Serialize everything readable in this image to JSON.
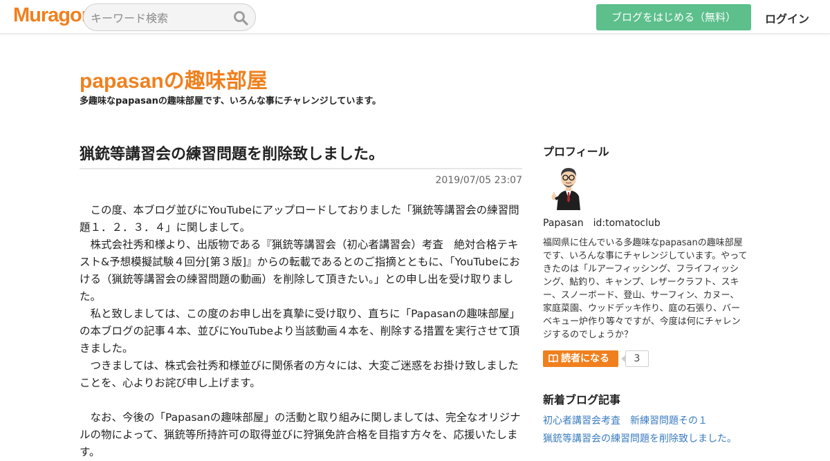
{
  "header": {
    "logo_text": "Muragon",
    "search_placeholder": "キーワード検索",
    "start_button": "ブログをはじめる（無料）",
    "login_link": "ログイン"
  },
  "blog": {
    "title": "papasanの趣味部屋",
    "description": "多趣味なpapasanの趣味部屋です、いろんな事にチャレンジしています。"
  },
  "article": {
    "title": "猟銃等講習会の練習問題を削除致しました。",
    "date": "2019/07/05 23:07",
    "paragraphs": [
      "　この度、本ブログ並びにYouTubeにアップロードしておりました「猟銃等講習会の練習問題１．２．３．４」に関しまして。",
      "　株式会社秀和様より、出版物である『猟銃等講習会（初心者講習会）考査　絶対合格テキスト&予想模擬試験４回分[第３版]』からの転載であるとのご指摘とともに、「YouTubeにおける（猟銃等講習会の練習問題の動画）を削除して頂きたい。」との申し出を受け取りました。",
      "　私と致しましては、この度のお申し出を真摯に受け取り、直ちに「Papasanの趣味部屋」の本ブログの記事４本、並びにYouTubeより当該動画４本を、削除する措置を実行させて頂きました。",
      "　つきましては、株式会社秀和様並びに関係者の方々には、大変ご迷惑をお掛け致しましたことを、心よりお詫び申し上げます。",
      "",
      "　なお、今後の「Papasanの趣味部屋」の活動と取り組みに関しましては、完全なオリジナルの物によって、猟銃等所持許可の取得並びに狩猟免許合格を目指す方々を、応援いたします。"
    ]
  },
  "sidebar": {
    "profile_heading": "プロフィール",
    "profile_name": "Papasan　id:tomatoclub",
    "profile_description": "福岡県に住んでいる多趣味なpapasanの趣味部屋です、いろんな事にチャレンジしています。やってきたのは「ルアーフィッシング、フライフィッシング、鮎釣り、キャンプ、レザークラフト、スキー、スノーボード、登山、サーフィン、カヌー、家庭菜園、ウッドデッキ作り、庭の石張り、バーベキュー炉作り等々ですが、今度は何にチャレンジするのでしょうか？",
    "reader_button": "読者になる",
    "reader_count": "3",
    "recent_heading": "新着ブログ記事",
    "recent_posts": [
      "初心者講習会考査　新練習問題その１",
      "猟銃等講習会の練習問題を削除致しました。"
    ]
  },
  "colors": {
    "brand_orange": "#f0801e",
    "start_button_green": "#5cbf8c",
    "link_blue": "#3a7bbf"
  }
}
